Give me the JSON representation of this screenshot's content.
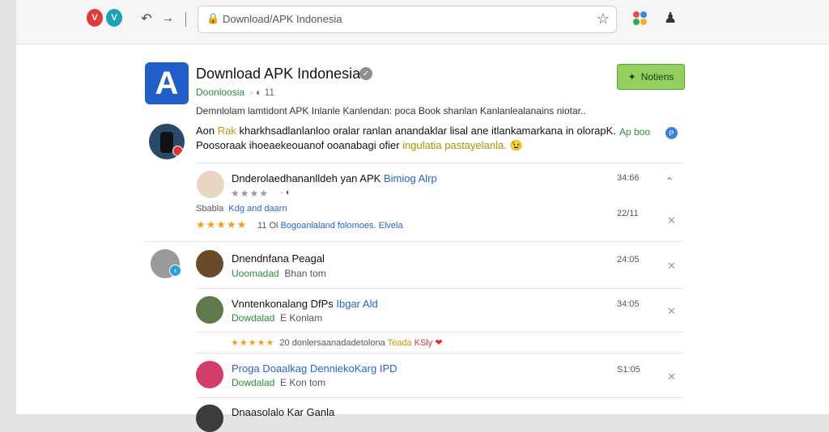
{
  "browser": {
    "url": "Download/APK Indonesia",
    "brand_a": "V",
    "brand_b": "V"
  },
  "app": {
    "logo_letter": "A",
    "title": "Download APK Indonesia",
    "subtitle": "Doonloosia",
    "subtitle_count": "11",
    "notification_button": "Notiens",
    "description": "Demnlolam lamtidont APK Inlanle Kanlendan: poca Book shanlan Kanlanlealanains niotar.."
  },
  "post": {
    "line1_start": "Aon ",
    "line1_highlight": "Rak",
    "line1_rest": " kharkhsadlanlanloo oralar ranlan anandaklar lisal ane itlankamarkana in olorapK.",
    "line2_start": "Poosoraak ihoeaekeouanof ooanabagi ofier ",
    "line2_highlight": "ingulatia pastayelanla.",
    "line2_emoji": "😉",
    "action_label": "Ap boo",
    "action_badge": "P"
  },
  "rows": [
    {
      "title": "Dnderolaedhananlldeh yan APK ",
      "title_link": "Bimiog Alrp",
      "time": "34:66",
      "time2": "22/11",
      "stars": "★★★★",
      "meta_label": "Sbabla",
      "meta_link": "Kdg and daarn",
      "rating_stars": "★★★★★",
      "rating_text": "11 Ol ",
      "rating_link": "Bogoanlaland folomoes. Elvela"
    },
    {
      "title": "Dnendnfana Peagal",
      "sub": "Uoomadad",
      "sub_rest": "Bhan tom",
      "time": "24:05"
    },
    {
      "title": "Vnntenkonalang DfPs ",
      "title_link": "Ibgar Ald",
      "sub": "Dowdalad",
      "sub_rest": "E Konlam",
      "time": "34:05"
    },
    {
      "title": "",
      "title_link": "Proga Doaalkag DenniekoKarg IPD",
      "sub": "Dowdalad",
      "sub_rest": "E Kon tom",
      "time": "S1:05"
    },
    {
      "title": "Dnaasolalo Kar Ganla"
    }
  ],
  "comment": {
    "stars": "★★★★★",
    "text": "20 donlersaanadadetolona ",
    "highlight": "Teada",
    "highlight2": "KSly",
    "heart": "❤"
  }
}
